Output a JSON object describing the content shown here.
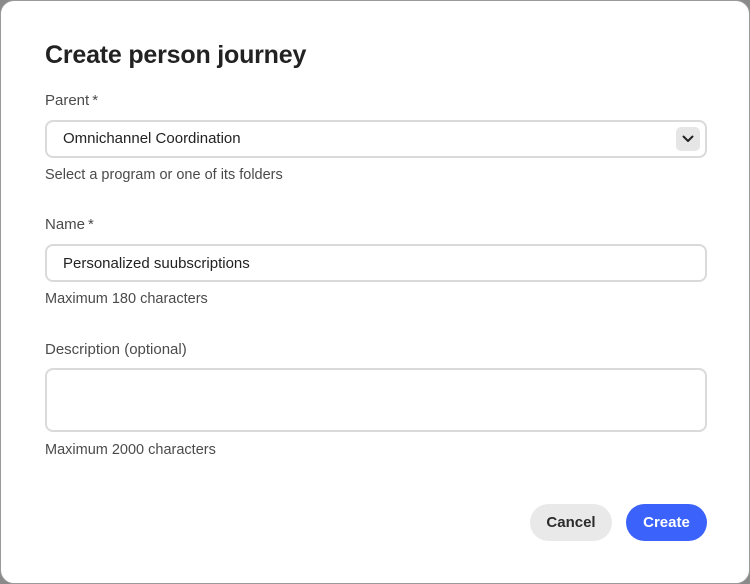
{
  "dialog": {
    "title": "Create person journey"
  },
  "parent": {
    "label": "Parent",
    "required_mark": "*",
    "value": "Omnichannel Coordination",
    "help": "Select a program or one of its folders"
  },
  "name": {
    "label": "Name",
    "required_mark": "*",
    "value": "Personalized suubscriptions",
    "help": "Maximum 180 characters"
  },
  "description": {
    "label": "Description (optional)",
    "value": "",
    "help": "Maximum 2000 characters"
  },
  "actions": {
    "cancel_label": "Cancel",
    "create_label": "Create"
  },
  "colors": {
    "primary": "#3b63fb",
    "secondary": "#e9e9e9"
  },
  "icons": {
    "parent_dropdown": "chevron-down-icon"
  }
}
